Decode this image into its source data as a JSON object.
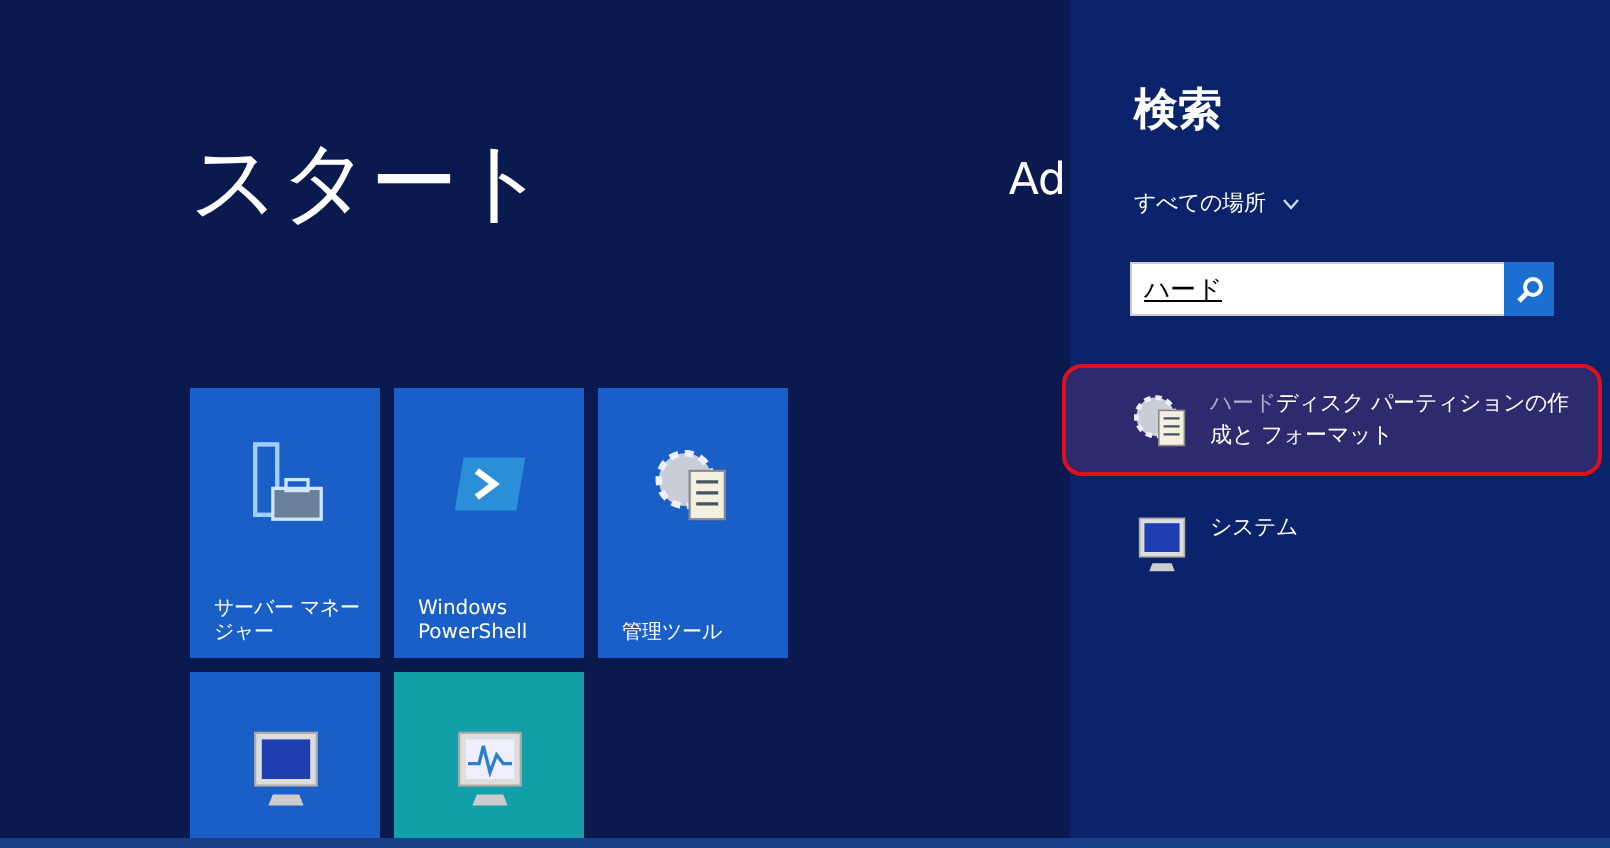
{
  "start": {
    "title": "スタート",
    "group_label": "Ad",
    "tiles": [
      {
        "label": "サーバー マネージャー",
        "kind": "server",
        "color": "#1a5fc8"
      },
      {
        "label": "Windows PowerShell",
        "kind": "shell",
        "color": "#1a5fc8"
      },
      {
        "label": "管理ツール",
        "kind": "gear",
        "color": "#1a5fc8"
      },
      {
        "kind": "monitor",
        "color": "#1a5fc8"
      },
      {
        "kind": "chart",
        "color": "#12a0a8"
      }
    ]
  },
  "search": {
    "title": "検索",
    "scope": "すべての場所",
    "value": "ハード",
    "results": [
      {
        "text": "ハード**ディスク パーティションの作成と フォーマット**",
        "kind": "gear",
        "selected": true
      },
      {
        "text": "システム",
        "kind": "monitor",
        "selected": false
      }
    ]
  }
}
